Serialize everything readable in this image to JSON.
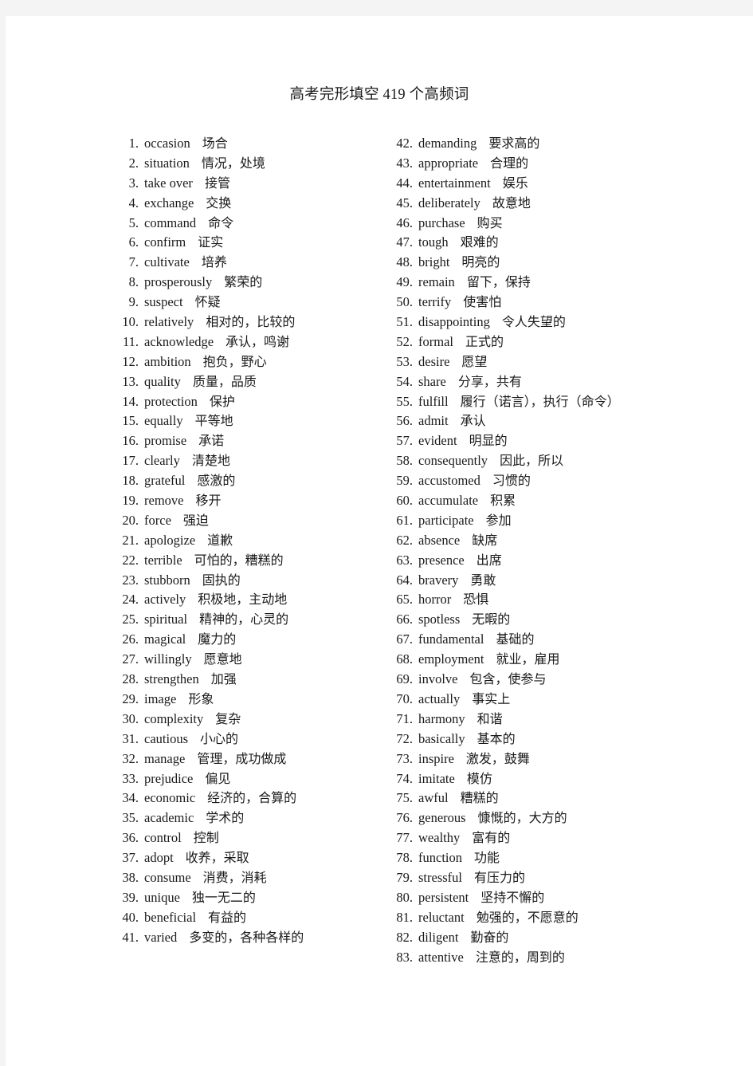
{
  "document": {
    "title": "高考完形填空 419 个高频词",
    "page_background": "#ffffff",
    "canvas_background": "#f4f4f4",
    "text_color": "#1a1a1a"
  },
  "columns": {
    "left": {
      "entries": [
        {
          "num": "1.",
          "word": "occasion",
          "meaning": "场合"
        },
        {
          "num": "2.",
          "word": "situation",
          "meaning": "情况，处境"
        },
        {
          "num": "3.",
          "word": "take over",
          "meaning": "接管"
        },
        {
          "num": "4.",
          "word": "exchange",
          "meaning": "交换"
        },
        {
          "num": "5.",
          "word": "command",
          "meaning": "命令"
        },
        {
          "num": "6.",
          "word": "confirm",
          "meaning": "证实"
        },
        {
          "num": "7.",
          "word": "cultivate",
          "meaning": "培养"
        },
        {
          "num": "8.",
          "word": "prosperously",
          "meaning": "繁荣的"
        },
        {
          "num": "9.",
          "word": "suspect",
          "meaning": "怀疑"
        },
        {
          "num": "10.",
          "word": "relatively",
          "meaning": "相对的，比较的"
        },
        {
          "num": "11.",
          "word": "acknowledge",
          "meaning": "承认，鸣谢"
        },
        {
          "num": "12.",
          "word": "ambition",
          "meaning": "抱负，野心"
        },
        {
          "num": "13.",
          "word": "quality",
          "meaning": "质量，品质"
        },
        {
          "num": "14.",
          "word": "protection",
          "meaning": "保护"
        },
        {
          "num": "15.",
          "word": "equally",
          "meaning": "平等地"
        },
        {
          "num": "16.",
          "word": "promise",
          "meaning": "承诺"
        },
        {
          "num": "17.",
          "word": "clearly",
          "meaning": "清楚地"
        },
        {
          "num": "18.",
          "word": "grateful",
          "meaning": "感激的"
        },
        {
          "num": "19.",
          "word": "remove",
          "meaning": "移开"
        },
        {
          "num": "20.",
          "word": "force",
          "meaning": "强迫"
        },
        {
          "num": "21.",
          "word": "apologize",
          "meaning": "道歉"
        },
        {
          "num": "22.",
          "word": "terrible",
          "meaning": "可怕的，糟糕的"
        },
        {
          "num": "23.",
          "word": "stubborn",
          "meaning": "固执的"
        },
        {
          "num": "24.",
          "word": "actively",
          "meaning": "积极地，主动地"
        },
        {
          "num": "25.",
          "word": "spiritual",
          "meaning": "精神的，心灵的"
        },
        {
          "num": "26.",
          "word": "magical",
          "meaning": "魔力的"
        },
        {
          "num": "27.",
          "word": "willingly",
          "meaning": "愿意地"
        },
        {
          "num": "28.",
          "word": "strengthen",
          "meaning": "加强"
        },
        {
          "num": "29.",
          "word": "image",
          "meaning": "形象"
        },
        {
          "num": "30.",
          "word": "complexity",
          "meaning": "复杂"
        },
        {
          "num": "31.",
          "word": "cautious",
          "meaning": "小心的"
        },
        {
          "num": "32.",
          "word": "manage",
          "meaning": "管理，成功做成"
        },
        {
          "num": "33.",
          "word": "prejudice",
          "meaning": "偏见"
        },
        {
          "num": "34.",
          "word": "economic",
          "meaning": "经济的，合算的"
        },
        {
          "num": "35.",
          "word": "academic",
          "meaning": "学术的"
        },
        {
          "num": "36.",
          "word": "control",
          "meaning": "控制"
        },
        {
          "num": "37.",
          "word": "adopt",
          "meaning": "收养，采取"
        },
        {
          "num": "38.",
          "word": "consume",
          "meaning": "消费，消耗"
        },
        {
          "num": "39.",
          "word": "unique",
          "meaning": "独一无二的"
        },
        {
          "num": "40.",
          "word": "beneficial",
          "meaning": "有益的"
        },
        {
          "num": "41.",
          "word": "varied",
          "meaning": "多变的，各种各样的"
        }
      ]
    },
    "right": {
      "entries": [
        {
          "num": "42.",
          "word": "demanding",
          "meaning": "要求高的"
        },
        {
          "num": "43.",
          "word": "appropriate",
          "meaning": "合理的"
        },
        {
          "num": "44.",
          "word": "entertainment",
          "meaning": "娱乐"
        },
        {
          "num": "45.",
          "word": "deliberately",
          "meaning": "故意地"
        },
        {
          "num": "46.",
          "word": "purchase",
          "meaning": "购买"
        },
        {
          "num": "47.",
          "word": "tough",
          "meaning": "艰难的"
        },
        {
          "num": "48.",
          "word": "bright",
          "meaning": "明亮的"
        },
        {
          "num": "49.",
          "word": "remain",
          "meaning": "留下，保持"
        },
        {
          "num": "50.",
          "word": "terrify",
          "meaning": "使害怕"
        },
        {
          "num": "51.",
          "word": "disappointing",
          "meaning": "令人失望的"
        },
        {
          "num": "52.",
          "word": "formal",
          "meaning": "正式的"
        },
        {
          "num": "53.",
          "word": "desire",
          "meaning": "愿望"
        },
        {
          "num": "54.",
          "word": "share",
          "meaning": "分享，共有"
        },
        {
          "num": "55.",
          "word": "fulfill",
          "meaning": "履行（诺言），执行（命令）"
        },
        {
          "num": "56.",
          "word": "admit",
          "meaning": "承认"
        },
        {
          "num": "57.",
          "word": "evident",
          "meaning": "明显的"
        },
        {
          "num": "58.",
          "word": "consequently",
          "meaning": "因此，所以"
        },
        {
          "num": "59.",
          "word": "accustomed",
          "meaning": "习惯的"
        },
        {
          "num": "60.",
          "word": "accumulate",
          "meaning": "积累"
        },
        {
          "num": "61.",
          "word": "participate",
          "meaning": "参加"
        },
        {
          "num": "62.",
          "word": "absence",
          "meaning": "缺席"
        },
        {
          "num": "63.",
          "word": "presence",
          "meaning": "出席"
        },
        {
          "num": "64.",
          "word": "bravery",
          "meaning": "勇敢"
        },
        {
          "num": "65.",
          "word": "horror",
          "meaning": "恐惧"
        },
        {
          "num": "66.",
          "word": "spotless",
          "meaning": "无暇的"
        },
        {
          "num": "67.",
          "word": "fundamental",
          "meaning": "基础的"
        },
        {
          "num": "68.",
          "word": "employment",
          "meaning": "就业，雇用"
        },
        {
          "num": "69.",
          "word": "involve",
          "meaning": "包含，使参与"
        },
        {
          "num": "70.",
          "word": "actually",
          "meaning": "事实上"
        },
        {
          "num": "71.",
          "word": "harmony",
          "meaning": "和谐"
        },
        {
          "num": "72.",
          "word": "basically",
          "meaning": "基本的"
        },
        {
          "num": "73.",
          "word": "inspire",
          "meaning": "激发，鼓舞"
        },
        {
          "num": "74.",
          "word": "imitate",
          "meaning": "模仿"
        },
        {
          "num": "75.",
          "word": "awful",
          "meaning": "糟糕的"
        },
        {
          "num": "76.",
          "word": "generous",
          "meaning": "慷慨的，大方的"
        },
        {
          "num": "77.",
          "word": "wealthy",
          "meaning": "富有的"
        },
        {
          "num": "78.",
          "word": "function",
          "meaning": "功能"
        },
        {
          "num": "79.",
          "word": "stressful",
          "meaning": "有压力的"
        },
        {
          "num": "80.",
          "word": "persistent",
          "meaning": "坚持不懈的"
        },
        {
          "num": "81.",
          "word": "reluctant",
          "meaning": "勉强的，不愿意的"
        },
        {
          "num": "82.",
          "word": "diligent",
          "meaning": "勤奋的"
        },
        {
          "num": "83.",
          "word": "attentive",
          "meaning": "注意的，周到的"
        }
      ]
    }
  }
}
